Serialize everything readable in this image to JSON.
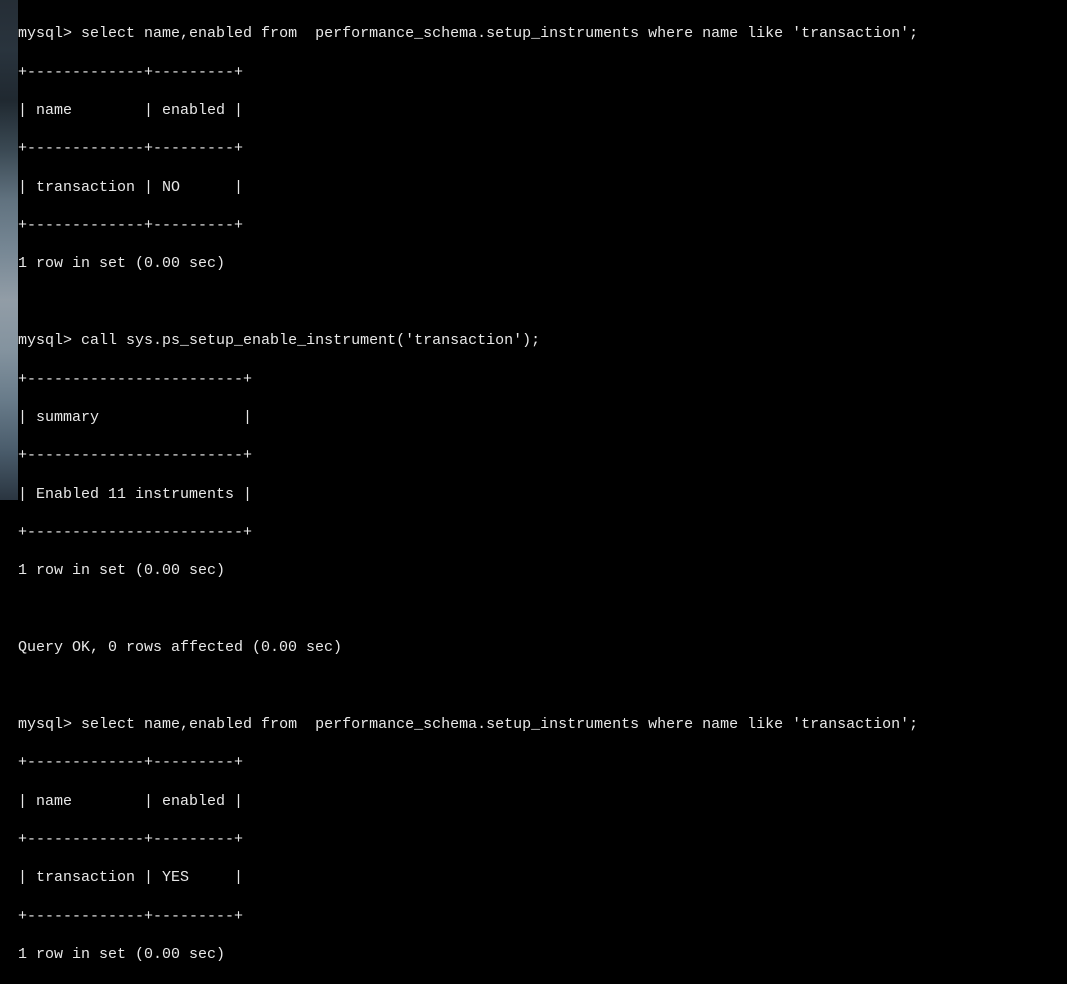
{
  "terminal": {
    "prompt": "mysql>",
    "blocks": [
      {
        "command": "select name,enabled from  performance_schema.setup_instruments where name like 'transaction';",
        "table": {
          "border_top": "+-------------+---------+",
          "header_row": "| name        | enabled |",
          "border_mid": "+-------------+---------+",
          "data_row": "| transaction | NO      |",
          "border_bot": "+-------------+---------+"
        },
        "status": "1 row in set (0.00 sec)"
      },
      {
        "command": "call sys.ps_setup_enable_instrument('transaction');",
        "table": {
          "border_top": "+------------------------+",
          "header_row": "| summary                |",
          "border_mid": "+------------------------+",
          "data_row": "| Enabled 11 instruments |",
          "border_bot": "+------------------------+"
        },
        "status": "1 row in set (0.00 sec)",
        "extra_status": "Query OK, 0 rows affected (0.00 sec)"
      },
      {
        "command": "select name,enabled from  performance_schema.setup_instruments where name like 'transaction';",
        "table": {
          "border_top": "+-------------+---------+",
          "header_row": "| name        | enabled |",
          "border_mid": "+-------------+---------+",
          "data_row": "| transaction | YES     |",
          "border_bot": "+-------------+---------+"
        },
        "status": "1 row in set (0.00 sec)"
      }
    ]
  }
}
